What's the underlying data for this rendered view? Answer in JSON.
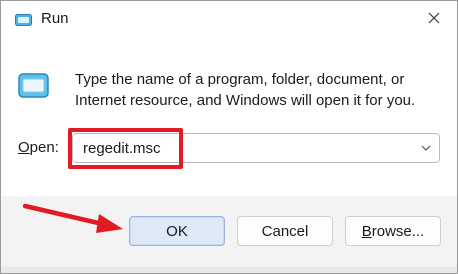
{
  "window": {
    "title": "Run"
  },
  "title_icon": "run-icon",
  "close_icon": "close-icon",
  "description": "Type the name of a program, folder, document, or Internet resource, and Windows will open it for you.",
  "open": {
    "label_prefix": "",
    "label_accel": "O",
    "label_rest": "pen:",
    "value": "regedit.msc"
  },
  "buttons": {
    "ok": "OK",
    "cancel": "Cancel",
    "browse_accel": "B",
    "browse_rest": "rowse..."
  },
  "colors": {
    "highlight": "#e01b24",
    "ok_bg": "#dde9f7",
    "footer_bg": "#f3f3f3"
  }
}
